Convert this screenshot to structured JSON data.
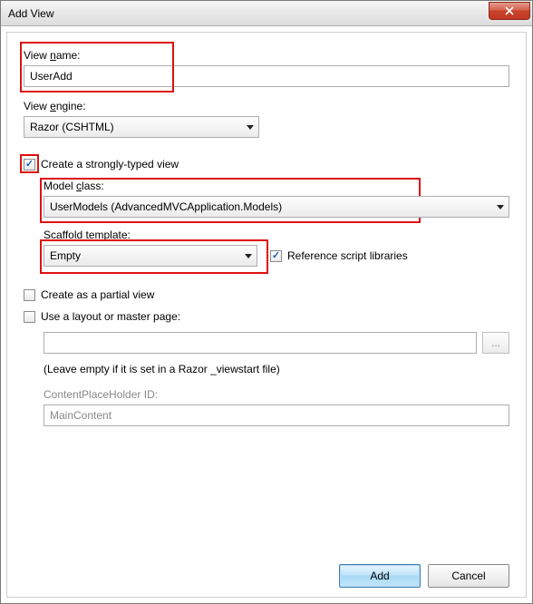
{
  "title": "Add View",
  "labels": {
    "viewName": "View name:",
    "viewNameMn": "n",
    "viewEngine": "View engine:",
    "viewEngineMn": "e",
    "stronglyTyped": "Create a strongly-typed view",
    "stronglyTypedMn": "s",
    "modelClass": "Model class:",
    "modelClassMn": "c",
    "scaffold": "Scaffold template:",
    "scaffoldMn": "f",
    "refScripts": "Reference script libraries",
    "refScriptsMn": "R",
    "partial": "Create as a partial view",
    "partialMn": "C",
    "layout": "Use a layout or master page:",
    "layoutMn": "U",
    "layoutHint": "(Leave empty if it is set in a Razor _viewstart file)",
    "cphId": "ContentPlaceHolder ID:",
    "browse": "..."
  },
  "values": {
    "viewName": "UserAdd",
    "viewEngine": "Razor (CSHTML)",
    "modelClass": "UserModels (AdvancedMVCApplication.Models)",
    "scaffold": "Empty",
    "layoutPath": "",
    "cphId": "MainContent"
  },
  "checks": {
    "stronglyTyped": true,
    "refScripts": true,
    "partial": false,
    "layout": false
  },
  "buttons": {
    "add": "Add",
    "addMn": "A",
    "cancel": "Cancel"
  }
}
